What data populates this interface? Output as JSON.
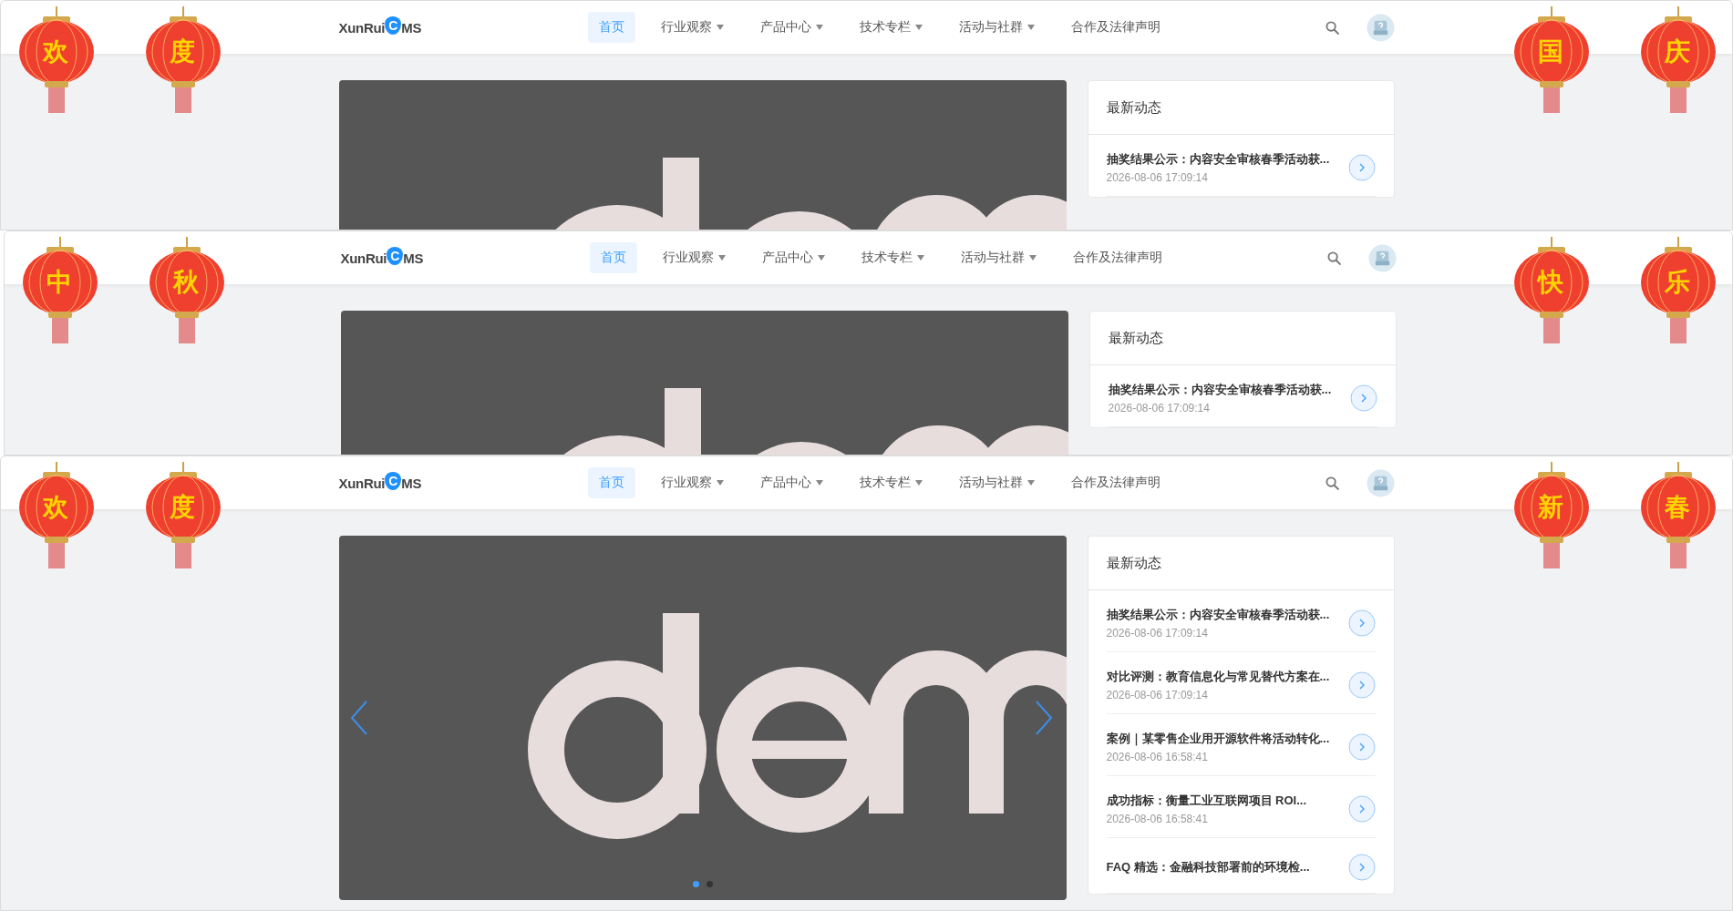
{
  "panels": [
    {
      "lanterns_left": [
        "欢",
        "度"
      ],
      "lanterns_right": [
        "国",
        "庆"
      ],
      "logo": {
        "left": "XunRui",
        "mark": "C",
        "right": "MS"
      },
      "nav": [
        {
          "label": "首页",
          "selected": true,
          "dropdown": false
        },
        {
          "label": "行业观察",
          "selected": false,
          "dropdown": true
        },
        {
          "label": "产品中心",
          "selected": false,
          "dropdown": true
        },
        {
          "label": "技术专栏",
          "selected": false,
          "dropdown": true
        },
        {
          "label": "活动与社群",
          "selected": false,
          "dropdown": true
        },
        {
          "label": "合作及法律声明",
          "selected": false,
          "dropdown": false
        }
      ],
      "sidebar": {
        "title": "最新动态",
        "items": [
          {
            "title": "抽奖结果公示：内容安全审核春季活动获...",
            "date": "2026-08-06 17:09:14"
          }
        ]
      }
    },
    {
      "lanterns_left": [
        "中",
        "秋"
      ],
      "lanterns_right": [
        "快",
        "乐"
      ],
      "logo": {
        "left": "XunRui",
        "mark": "C",
        "right": "MS"
      },
      "nav": [
        {
          "label": "首页",
          "selected": true,
          "dropdown": false
        },
        {
          "label": "行业观察",
          "selected": false,
          "dropdown": true
        },
        {
          "label": "产品中心",
          "selected": false,
          "dropdown": true
        },
        {
          "label": "技术专栏",
          "selected": false,
          "dropdown": true
        },
        {
          "label": "活动与社群",
          "selected": false,
          "dropdown": true
        },
        {
          "label": "合作及法律声明",
          "selected": false,
          "dropdown": false
        }
      ],
      "sidebar": {
        "title": "最新动态",
        "items": [
          {
            "title": "抽奖结果公示：内容安全审核春季活动获...",
            "date": "2026-08-06 17:09:14"
          }
        ]
      }
    },
    {
      "lanterns_left": [
        "欢",
        "度"
      ],
      "lanterns_right": [
        "新",
        "春"
      ],
      "logo": {
        "left": "XunRui",
        "mark": "C",
        "right": "MS"
      },
      "nav": [
        {
          "label": "首页",
          "selected": true,
          "dropdown": false
        },
        {
          "label": "行业观察",
          "selected": false,
          "dropdown": true
        },
        {
          "label": "产品中心",
          "selected": false,
          "dropdown": true
        },
        {
          "label": "技术专栏",
          "selected": false,
          "dropdown": true
        },
        {
          "label": "活动与社群",
          "selected": false,
          "dropdown": true
        },
        {
          "label": "合作及法律声明",
          "selected": false,
          "dropdown": false
        }
      ],
      "carousel_controls": {
        "dots": [
          {
            "selected": true
          },
          {
            "selected": false
          }
        ]
      },
      "sidebar": {
        "title": "最新动态",
        "items": [
          {
            "title": "抽奖结果公示：内容安全审核春季活动获...",
            "date": "2026-08-06 17:09:14"
          },
          {
            "title": "对比评测：教育信息化与常见替代方案在...",
            "date": "2026-08-06 17:09:14"
          },
          {
            "title": "案例｜某零售企业用开源软件将活动转化...",
            "date": "2026-08-06 16:58:41"
          },
          {
            "title": "成功指标：衡量工业互联网项目 ROI...",
            "date": "2026-08-06 16:58:41"
          },
          {
            "title": "FAQ 精选：金融科技部署前的环境检..."
          }
        ]
      }
    }
  ]
}
